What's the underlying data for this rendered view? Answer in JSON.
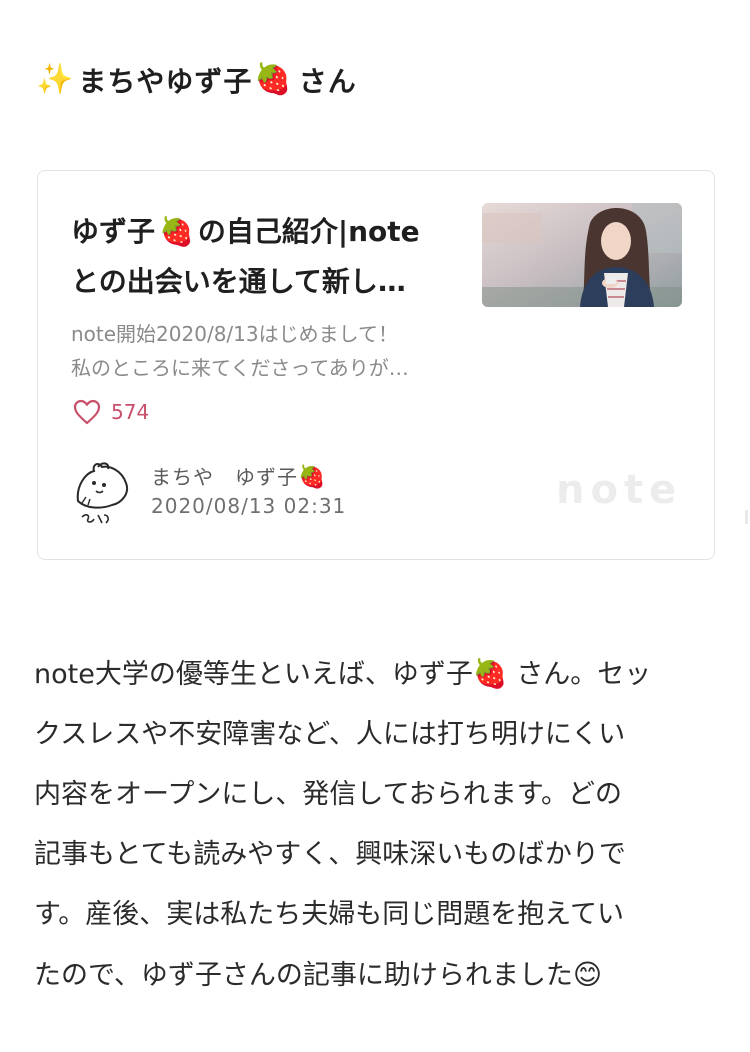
{
  "heading": {
    "sparkle_icon": "✨",
    "name": "まちやゆず子",
    "strawberry_icon": "🍓",
    "suffix": "さん"
  },
  "card": {
    "title_line1_a": "ゆず子",
    "title_strawberry_icon": "🍓",
    "title_line1_b": "の自己紹介|note",
    "title_line2": "との出会いを通して新し…",
    "description_line1": "note開始2020/8/13はじめまして！",
    "description_line2": "私のところに来てくださってありが…",
    "like_count": "574",
    "author_name": "まちや　ゆず子",
    "author_strawberry_icon": "🍓",
    "date": "2020/08/13 02:31",
    "brand": "note",
    "heart_color": "#c8506a"
  },
  "body": {
    "line1_a": "note大学の優等生といえば、ゆず子",
    "line1_icon": "🍓",
    "line1_b": "さん。セッ",
    "line2": "クスレスや不安障害など、人には打ち明けにくい",
    "line3": "内容をオープンにし、発信しておられます。どの",
    "line4": "記事もとても読みやすく、興味深いものばかりで",
    "line5": "す。産後、実は私たち夫婦も同じ問題を抱えてい",
    "line6": "たので、ゆず子さんの記事に助けられました",
    "line6_icon": "😊"
  }
}
